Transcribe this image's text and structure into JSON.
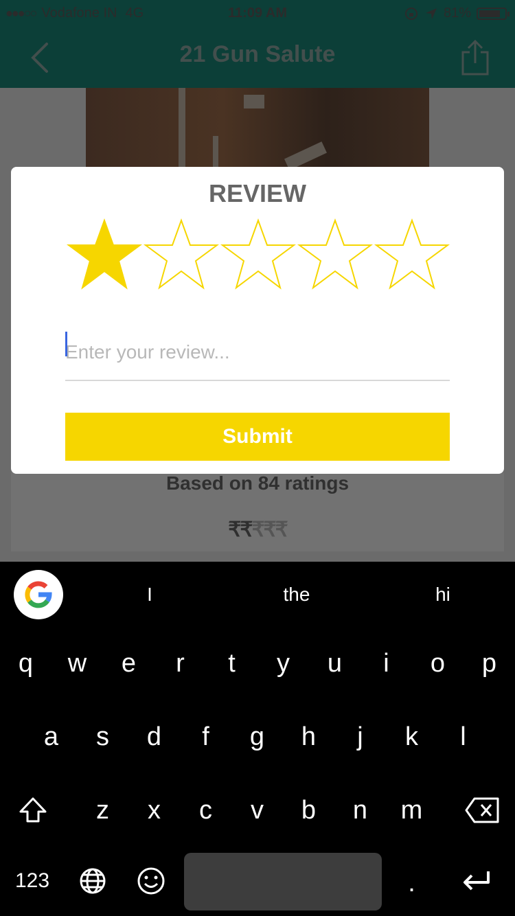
{
  "status_bar": {
    "carrier": "Vodafone IN",
    "network": "4G",
    "time": "11:09 AM",
    "battery": "81%"
  },
  "nav": {
    "title": "21 Gun Salute"
  },
  "content": {
    "ratings_text": "Based on 84 ratings",
    "price_active": "₹₹",
    "price_inactive": "₹₹₹"
  },
  "review": {
    "title": "REVIEW",
    "rating": 1,
    "max_rating": 5,
    "input_placeholder": "Enter your review...",
    "input_value": "",
    "submit_label": "Submit",
    "star_color": "#f6d600"
  },
  "keyboard": {
    "suggestions": [
      "I",
      "the",
      "hi"
    ],
    "row1": [
      "q",
      "w",
      "e",
      "r",
      "t",
      "y",
      "u",
      "i",
      "o",
      "p"
    ],
    "row2": [
      "a",
      "s",
      "d",
      "f",
      "g",
      "h",
      "j",
      "k",
      "l"
    ],
    "row3": [
      "z",
      "x",
      "c",
      "v",
      "b",
      "n",
      "m"
    ],
    "numbers_label": "123",
    "period_label": "."
  },
  "colors": {
    "nav_bg": "#0c3f38",
    "accent_yellow": "#f6d600"
  }
}
